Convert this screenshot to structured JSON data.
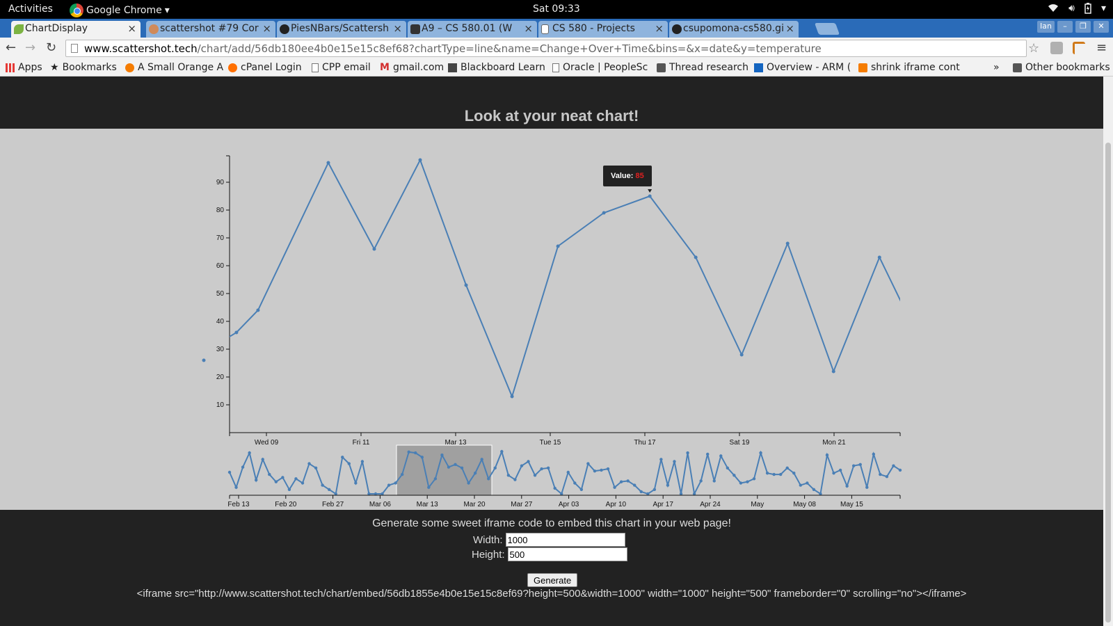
{
  "topbar": {
    "activities": "Activities",
    "app": "Google Chrome",
    "clock": "Sat 09:33"
  },
  "tabs": [
    {
      "label": "ChartDisplay",
      "active": true,
      "icon_color": "#7cb342"
    },
    {
      "label": "scattershot #79 Cor",
      "active": false,
      "icon_color": "#d08a5a"
    },
    {
      "label": "PiesNBars/Scattersh",
      "active": false,
      "icon_color": "#222222"
    },
    {
      "label": "A9 – CS 580.01 (W",
      "active": false,
      "icon_color": "#333333"
    },
    {
      "label": "CS 580 - Projects",
      "active": false,
      "icon_color": "#ffffff"
    },
    {
      "label": "csupomona-cs580.gi",
      "active": false,
      "icon_color": "#222222"
    }
  ],
  "window": {
    "user": "Ian"
  },
  "omnibox": {
    "host": "www.scattershot.tech",
    "path": "/chart/add/56db180ee4b0e15e15c8ef68?chartType=line&name=Change+Over+Time&bins=&x=date&y=temperature"
  },
  "bookmarks": {
    "items": [
      {
        "label": "Apps",
        "icon_color": "#e53935"
      },
      {
        "label": "Bookmarks",
        "icon_color": "#555555"
      },
      {
        "label": "A Small Orange A",
        "icon_color": "#f57c00"
      },
      {
        "label": "cPanel Login",
        "icon_color": "#ff6f00"
      },
      {
        "label": "CPP email",
        "icon_color": "#ffffff"
      },
      {
        "label": "gmail.com",
        "icon_color": "#d32f2f"
      },
      {
        "label": "Blackboard Learn",
        "icon_color": "#444444"
      },
      {
        "label": "Oracle | PeopleSc",
        "icon_color": "#ffffff"
      },
      {
        "label": "Thread research",
        "icon_color": "#555555"
      },
      {
        "label": "Overview - ARM (",
        "icon_color": "#1565c0"
      },
      {
        "label": "shrink iframe cont",
        "icon_color": "#f57c00"
      }
    ],
    "overflow": "»",
    "other": "Other bookmarks"
  },
  "page": {
    "heading": "Look at your neat chart!",
    "embed_note": "Generate some sweet iframe code to embed this chart in your web page!",
    "width_label": "Width:",
    "width_value": "1000",
    "height_label": "Height:",
    "height_value": "500",
    "generate_label": "Generate",
    "iframe_code": "<iframe src=\"http://www.scattershot.tech/chart/embed/56db1855e4b0e15e15c8ef69?height=500&width=1000\" width=\"1000\" height=\"500\" frameborder=\"0\" scrolling=\"no\"></iframe>"
  },
  "tooltip": {
    "label": "Value:",
    "value": "85"
  },
  "colors": {
    "line": "#4a7fb5",
    "brush": "#a0a0a0"
  },
  "chart_data": [
    {
      "type": "line",
      "title": "",
      "xlabel": "",
      "ylabel": "",
      "ylim": [
        0,
        98
      ],
      "y_ticks": [
        10,
        20,
        30,
        40,
        50,
        60,
        70,
        80,
        90
      ],
      "x_ticks": [
        "Wed 09",
        "Fri 11",
        "Mar 13",
        "Tue 15",
        "Thu 17",
        "Sat 19",
        "Mon 21"
      ],
      "x_domain": [
        "2016-03-08",
        "2016-03-22"
      ],
      "series": [
        {
          "x": [
            "2016-03-07",
            "2016-03-08",
            "2016-03-08",
            "2016-03-10",
            "2016-03-11",
            "2016-03-12",
            "2016-03-13",
            "2016-03-14",
            "2016-03-15",
            "2016-03-16",
            "2016-03-17",
            "2016-03-18",
            "2016-03-19",
            "2016-03-20",
            "2016-03-21",
            "2016-03-22",
            "2016-03-23"
          ],
          "y": [
            26,
            36,
            44,
            97,
            66,
            98,
            53,
            13,
            67,
            79,
            85,
            63,
            28,
            68,
            22,
            63,
            29
          ]
        }
      ]
    },
    {
      "type": "line",
      "title": "",
      "xlabel": "",
      "ylabel": "",
      "x_ticks": [
        "Feb 13",
        "Feb 20",
        "Feb 27",
        "Mar 06",
        "Mar 13",
        "Mar 20",
        "Mar 27",
        "Apr 03",
        "Apr 10",
        "Apr 17",
        "Apr 24",
        "May",
        "May 08",
        "May 15"
      ],
      "brush": [
        "2016-03-08",
        "2016-03-22"
      ],
      "series": [
        {
          "y": [
            50,
            15,
            62,
            95,
            32,
            80,
            45,
            28,
            38,
            10,
            35,
            25,
            70,
            60,
            20,
            10,
            0,
            85,
            70,
            25,
            75,
            0,
            0,
            0,
            20,
            25,
            45,
            97,
            95,
            85,
            15,
            35,
            90,
            62,
            68,
            60,
            25,
            48,
            80,
            35,
            60,
            98,
            43,
            33,
            65,
            75,
            43,
            58,
            60,
            13,
            0,
            50,
            25,
            10,
            70,
            53,
            55,
            58,
            15,
            28,
            30,
            20,
            5,
            0,
            10,
            80,
            20,
            75,
            0,
            95,
            0,
            30,
            92,
            30,
            88,
            60,
            43,
            25,
            28,
            35,
            95,
            48,
            45,
            45,
            60,
            48,
            20,
            25,
            10,
            0,
            90,
            48,
            55,
            18,
            65,
            68,
            15,
            92,
            45,
            40,
            65,
            55
          ]
        }
      ]
    }
  ]
}
